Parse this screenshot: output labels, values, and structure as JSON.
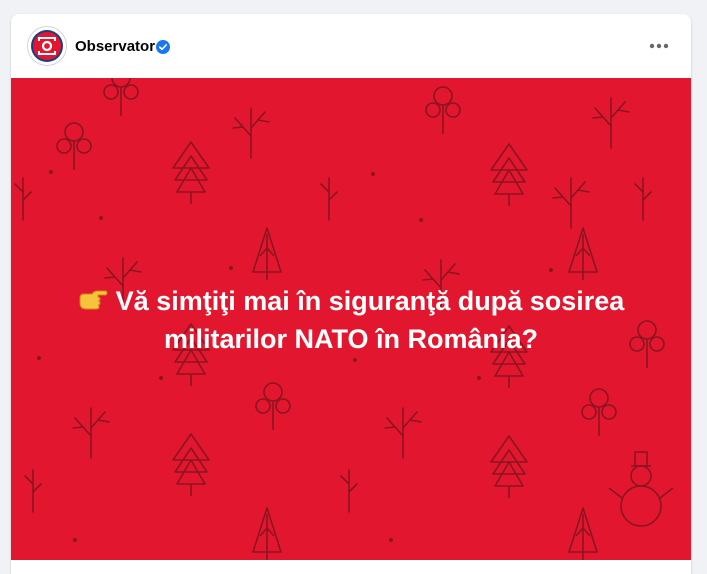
{
  "post": {
    "author": "Observator",
    "verified": true,
    "avatar_icon": "observator-logo-icon",
    "more_icon": "more-options-icon"
  },
  "banner": {
    "background_color": "#e2172f",
    "pattern_icons": [
      "tree-icon",
      "bare-tree-icon",
      "snowman-icon"
    ],
    "emoji_icon": "pointing-finger-icon",
    "text_line1": "Vă simţiţi mai în siguranţă după sosirea",
    "text_line2": "militarilor NATO în România?"
  }
}
